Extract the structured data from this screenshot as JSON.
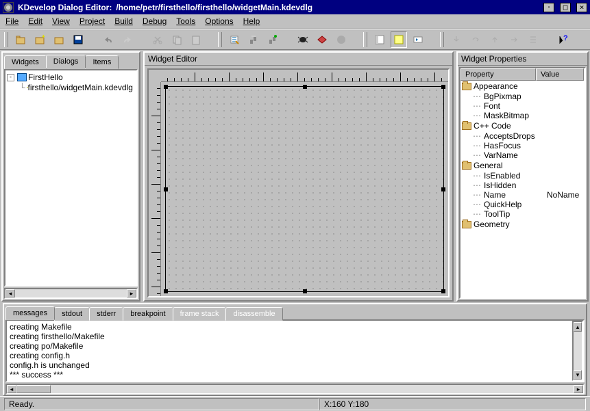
{
  "title_app": "KDevelop Dialog Editor: ",
  "title_path": "/home/petr/firsthello/firsthello/widgetMain.kdevdlg",
  "menu": {
    "file": "File",
    "edit": "Edit",
    "view": "View",
    "project": "Project",
    "build": "Build",
    "debug": "Debug",
    "tools": "Tools",
    "options": "Options",
    "help": "Help"
  },
  "left": {
    "tabs": {
      "widgets": "Widgets",
      "dialogs": "Dialogs",
      "items": "Items"
    },
    "tree_root": "FirstHello",
    "tree_child": "firsthello/widgetMain.kdevdlg"
  },
  "center": {
    "title": "Widget Editor"
  },
  "right": {
    "title": "Widget Properties",
    "col_prop": "Property",
    "col_val": "Value",
    "groups": [
      {
        "name": "Appearance",
        "items": [
          {
            "name": "BgPixmap",
            "value": ""
          },
          {
            "name": "Font",
            "value": ""
          },
          {
            "name": "MaskBitmap",
            "value": ""
          }
        ]
      },
      {
        "name": "C++ Code",
        "items": [
          {
            "name": "AcceptsDrops",
            "value": ""
          },
          {
            "name": "HasFocus",
            "value": ""
          },
          {
            "name": "VarName",
            "value": ""
          }
        ]
      },
      {
        "name": "General",
        "items": [
          {
            "name": "IsEnabled",
            "value": ""
          },
          {
            "name": "IsHidden",
            "value": ""
          },
          {
            "name": "Name",
            "value": "NoName"
          },
          {
            "name": "QuickHelp",
            "value": ""
          },
          {
            "name": "ToolTip",
            "value": ""
          }
        ]
      },
      {
        "name": "Geometry",
        "items": []
      }
    ]
  },
  "bottom": {
    "tabs": {
      "messages": "messages",
      "stdout": "stdout",
      "stderr": "stderr",
      "breakpoint": "breakpoint",
      "framestack": "frame stack",
      "disassemble": "disassemble"
    },
    "lines": [
      "creating Makefile",
      "creating firsthello/Makefile",
      "creating po/Makefile",
      "creating config.h",
      "config.h is unchanged",
      "*** success ***"
    ]
  },
  "status": {
    "ready": "Ready.",
    "coords": "X:160 Y:180"
  }
}
